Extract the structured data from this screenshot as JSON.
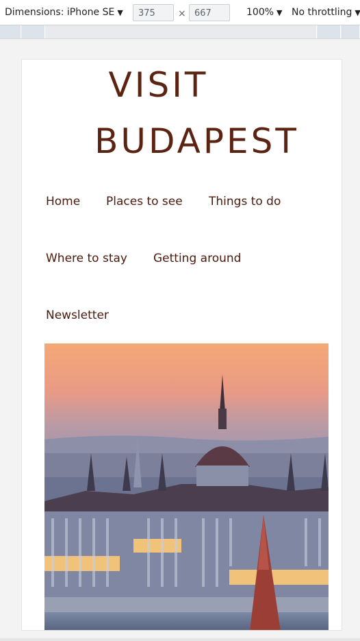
{
  "devtools": {
    "device_label": "Dimensions: iPhone SE",
    "width_value": "375",
    "height_value": "667",
    "times_symbol": "×",
    "zoom_label": "100%",
    "throttle_label": "No throttling",
    "caret": "▼"
  },
  "site": {
    "title_line1": "VISIT",
    "title_line2": "BUDAPEST",
    "title_color": "#5b2412"
  },
  "nav": {
    "items": [
      {
        "label": "Home"
      },
      {
        "label": "Places to see"
      },
      {
        "label": "Things to do"
      },
      {
        "label": "Where to stay"
      },
      {
        "label": "Getting around"
      },
      {
        "label": "Newsletter"
      }
    ]
  },
  "hero": {
    "subject": "Hungarian Parliament Building at sunset"
  }
}
